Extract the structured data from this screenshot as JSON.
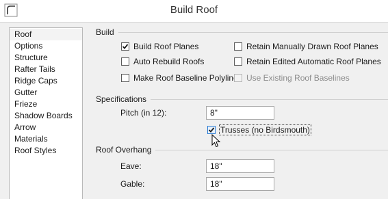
{
  "window": {
    "title": "Build Roof"
  },
  "sidebar": {
    "items": [
      {
        "label": "Roof",
        "selected": true
      },
      {
        "label": "Options"
      },
      {
        "label": "Structure"
      },
      {
        "label": "Rafter Tails"
      },
      {
        "label": "Ridge Caps"
      },
      {
        "label": "Gutter"
      },
      {
        "label": "Frieze"
      },
      {
        "label": "Shadow Boards"
      },
      {
        "label": "Arrow"
      },
      {
        "label": "Materials"
      },
      {
        "label": "Roof Styles"
      }
    ]
  },
  "build": {
    "heading": "Build",
    "build_roof_planes": {
      "label": "Build Roof Planes",
      "checked": true
    },
    "auto_rebuild_roofs": {
      "label": "Auto Rebuild Roofs",
      "checked": false
    },
    "make_baseline_polylines": {
      "label": "Make Roof Baseline Polylines",
      "checked": false
    },
    "retain_manual_planes": {
      "label": "Retain Manually Drawn Roof Planes",
      "checked": false
    },
    "retain_edited_planes": {
      "label": "Retain Edited Automatic Roof Planes",
      "checked": false
    },
    "use_existing_baselines": {
      "label": "Use Existing Roof Baselines",
      "checked": false,
      "disabled": true
    }
  },
  "specifications": {
    "heading": "Specifications",
    "pitch_label": "Pitch (in 12):",
    "pitch_value": "8\"",
    "trusses": {
      "label": "Trusses (no Birdsmouth)",
      "checked": true
    }
  },
  "overhang": {
    "heading": "Roof Overhang",
    "eave_label": "Eave:",
    "eave_value": "18\"",
    "gable_label": "Gable:",
    "gable_value": "18\""
  },
  "colors": {
    "checkmark": "#1a1a1a",
    "hover_border": "#2a7bd3"
  }
}
